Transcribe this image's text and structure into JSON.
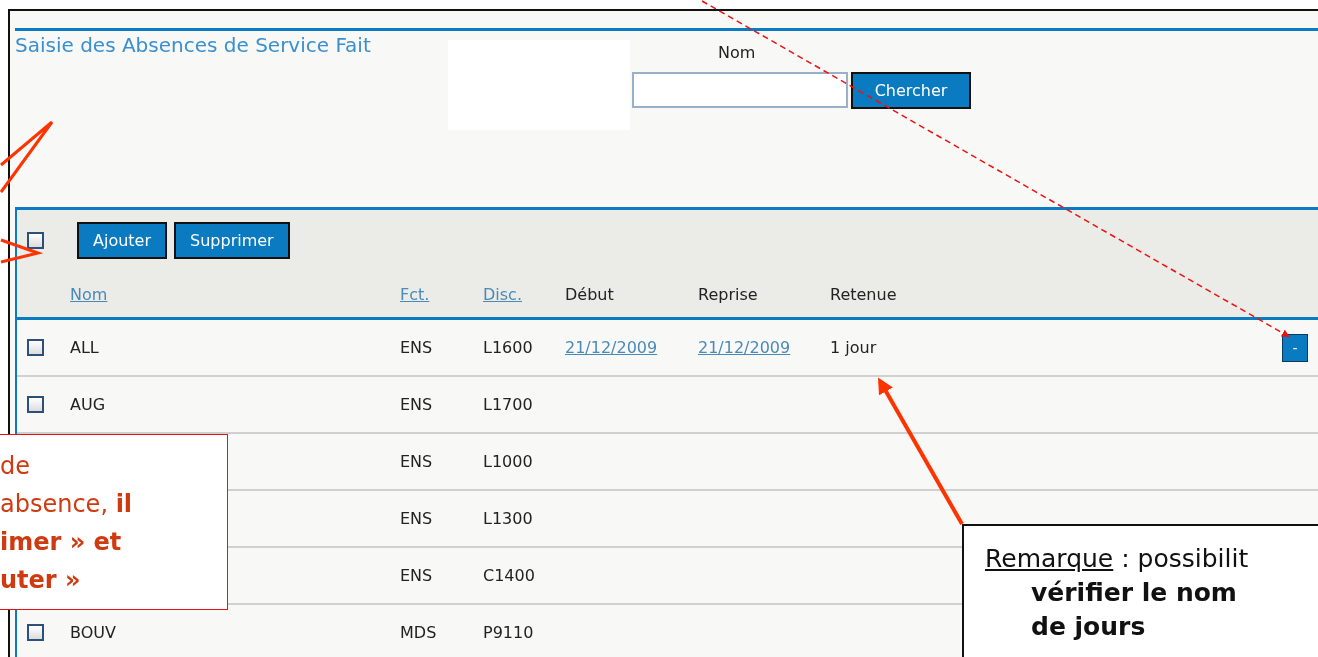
{
  "title": "Saisie des Absences de Service Fait",
  "search": {
    "label": "Nom",
    "button": "Chercher"
  },
  "toolbar": {
    "select_all": {
      "checked": false
    },
    "buttons": [
      "Ajouter",
      "Supprimer"
    ]
  },
  "columns": [
    {
      "label": "Nom",
      "kind": "link"
    },
    {
      "label": "Fct.",
      "kind": "link"
    },
    {
      "label": "Disc.",
      "kind": "link"
    },
    {
      "label": "Début",
      "kind": "plain"
    },
    {
      "label": "Reprise",
      "kind": "plain"
    },
    {
      "label": "Retenue",
      "kind": "plain"
    }
  ],
  "rows": [
    {
      "checked": false,
      "nom": "ALL",
      "fct": "ENS",
      "disc": "L1600",
      "debut": "21/12/2009",
      "reprise": "21/12/2009",
      "retenue": "1 jour",
      "remove_button": "-"
    },
    {
      "checked": false,
      "nom": "AUG",
      "fct": "ENS",
      "disc": "L1700"
    },
    {
      "fct": "ENS",
      "disc": "L1000"
    },
    {
      "fct": "ENS",
      "disc": "L1300"
    },
    {
      "fct": "ENS",
      "disc": "C1400"
    },
    {
      "checked": false,
      "nom": "BOUV",
      "fct": "MDS",
      "disc": "P9110"
    }
  ],
  "left_note": {
    "lines": [
      "de",
      "absence, **il**",
      "**imer » et**",
      "**uter »**"
    ]
  },
  "right_note": {
    "label": "Remarque",
    "first_line": " : possibilit",
    "lines": [
      "vérifier le nom",
      "de jours"
    ]
  }
}
